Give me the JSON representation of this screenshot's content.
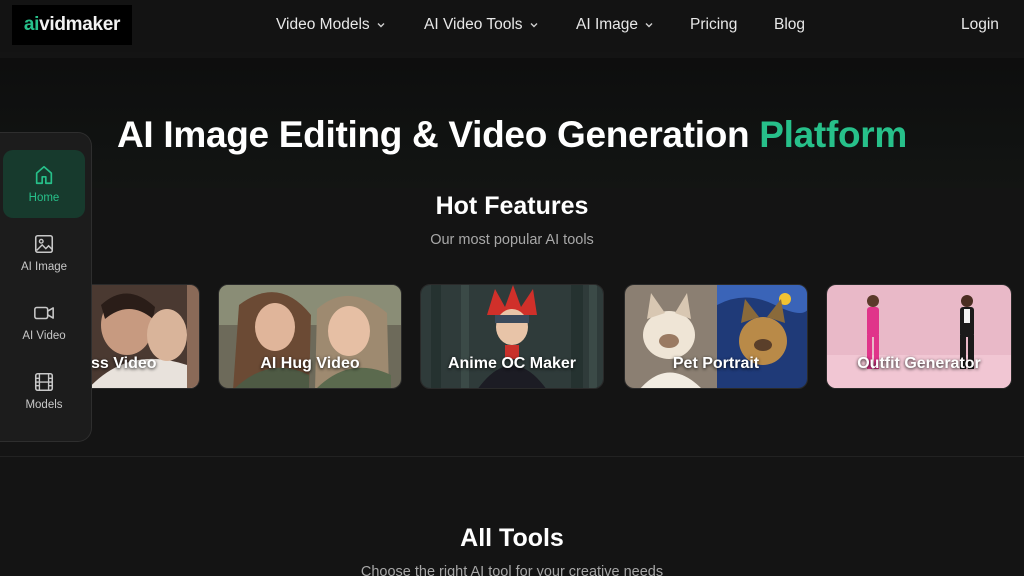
{
  "header": {
    "logo": {
      "ai": "ai",
      "rest": "vidmaker"
    },
    "nav": [
      {
        "label": "Video Models",
        "dropdown": true
      },
      {
        "label": "AI Video Tools",
        "dropdown": true
      },
      {
        "label": "AI Image",
        "dropdown": true
      },
      {
        "label": "Pricing",
        "dropdown": false
      },
      {
        "label": "Blog",
        "dropdown": false
      }
    ],
    "login": "Login"
  },
  "hero": {
    "title_main": "AI Image Editing & Video Generation ",
    "title_accent": "Platform"
  },
  "hot_features": {
    "title": "Hot Features",
    "subtitle": "Our most popular AI tools",
    "cards": [
      {
        "label": "ss Video"
      },
      {
        "label": "AI Hug Video"
      },
      {
        "label": "Anime OC Maker"
      },
      {
        "label": "Pet Portrait"
      },
      {
        "label": "Outfit Generator"
      }
    ]
  },
  "sidebar": {
    "items": [
      {
        "label": "Home",
        "icon": "home-icon",
        "active": true
      },
      {
        "label": "AI Image",
        "icon": "image-icon",
        "active": false
      },
      {
        "label": "AI Video",
        "icon": "video-camera-icon",
        "active": false
      },
      {
        "label": "Models",
        "icon": "film-icon",
        "active": false
      }
    ]
  },
  "all_tools": {
    "title": "All Tools",
    "subtitle": "Choose the right AI tool for your creative needs"
  },
  "colors": {
    "accent": "#27c08a",
    "background": "#141414",
    "sidebar_active": "#173a2d"
  }
}
